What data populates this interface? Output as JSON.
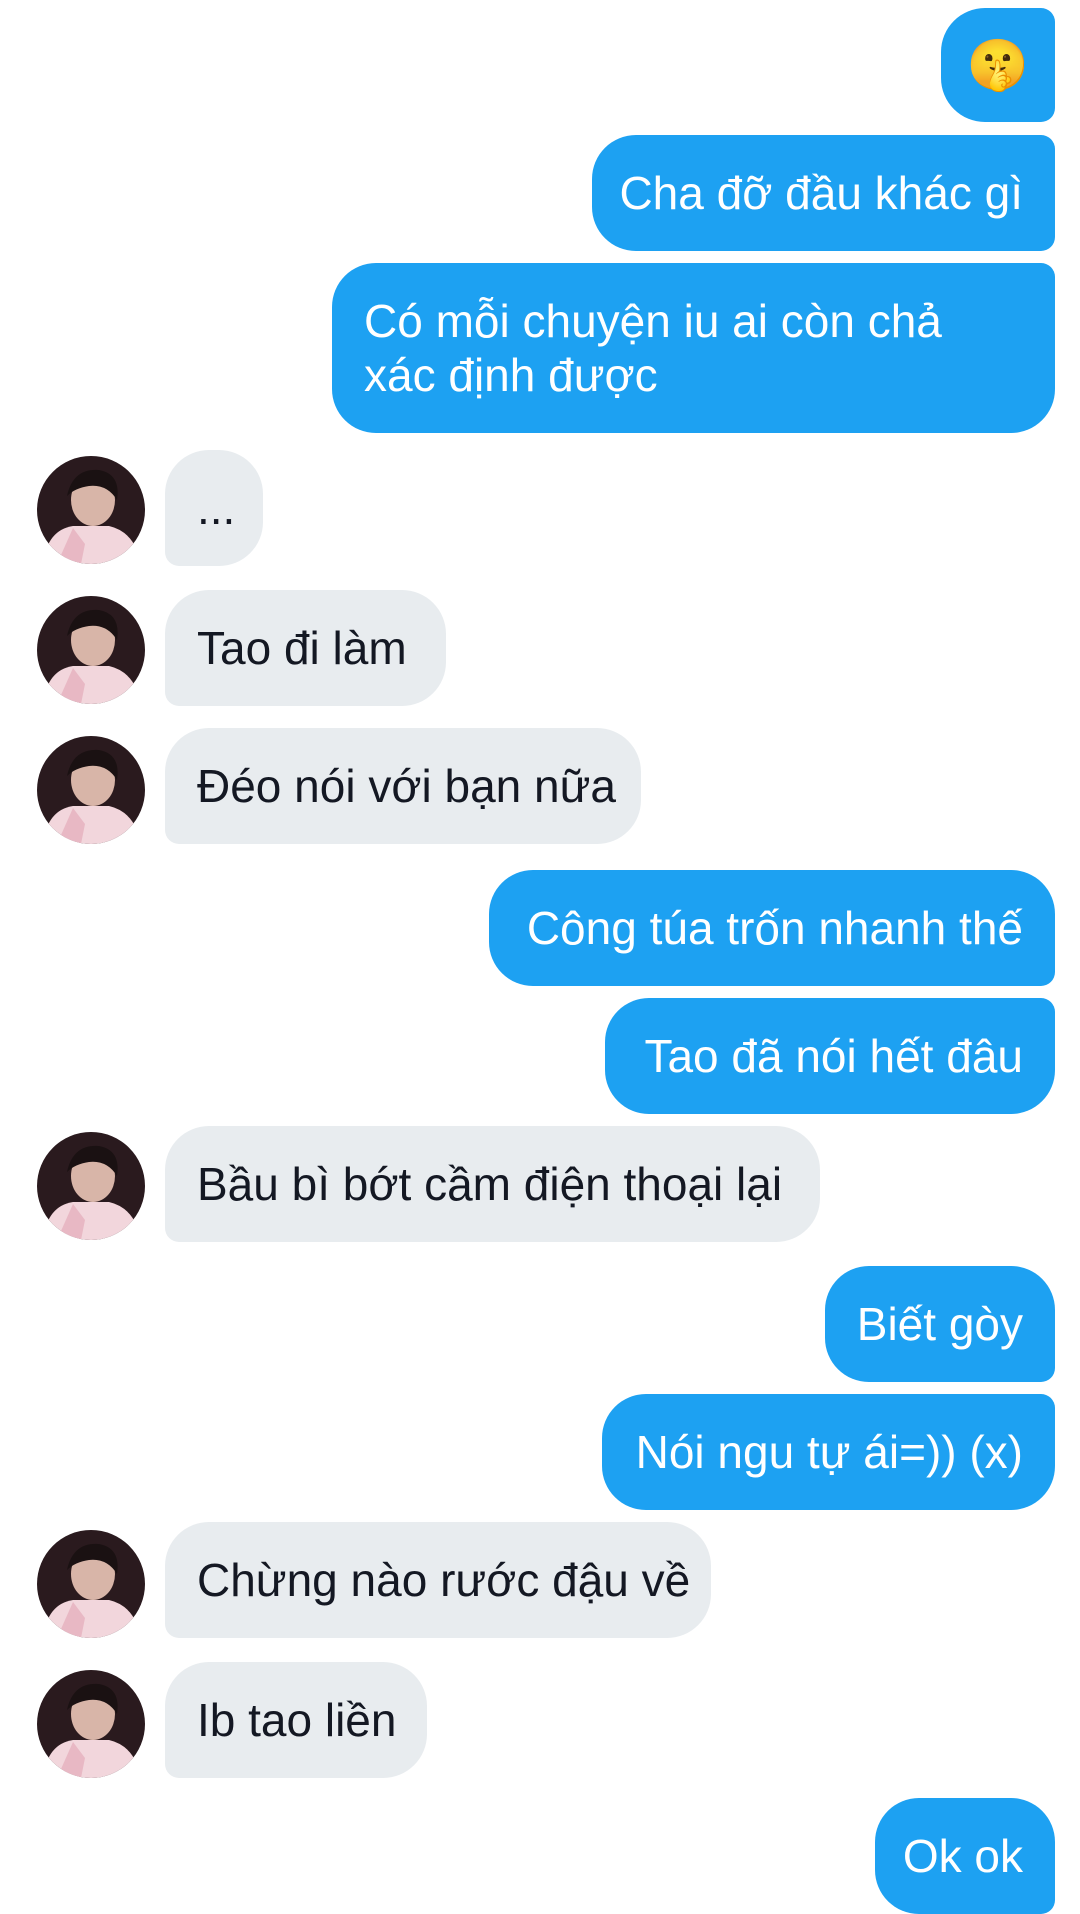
{
  "conversation": {
    "messages": [
      {
        "side": "sent",
        "text": "🤫"
      },
      {
        "side": "sent",
        "text": "Cha đỡ đầu khác gì"
      },
      {
        "side": "sent",
        "text": "Có mỗi chuyện iu ai còn chả xác định được"
      },
      {
        "side": "received",
        "text": "..."
      },
      {
        "side": "received",
        "text": "Tao đi làm"
      },
      {
        "side": "received",
        "text": "Đéo nói với bạn nữa"
      },
      {
        "side": "sent",
        "text": "Công túa trốn nhanh thế"
      },
      {
        "side": "sent",
        "text": "Tao đã nói hết đâu"
      },
      {
        "side": "received",
        "text": "Bầu bì bớt cầm điện thoại lại"
      },
      {
        "side": "sent",
        "text": "Biết gòy"
      },
      {
        "side": "sent",
        "text": "Nói ngu tự ái=)) (x)"
      },
      {
        "side": "received",
        "text": "Chừng nào rước đậu về"
      },
      {
        "side": "received",
        "text": "Ib tao liền"
      },
      {
        "side": "sent",
        "text": "Ok ok"
      }
    ]
  },
  "colors": {
    "sent_bubble": "#1da1f2",
    "received_bubble": "#e8ecef",
    "sent_text": "#ffffff",
    "received_text": "#141823"
  },
  "icons": {
    "emoji": "shushing-face-emoji",
    "avatar": "contact-avatar"
  }
}
